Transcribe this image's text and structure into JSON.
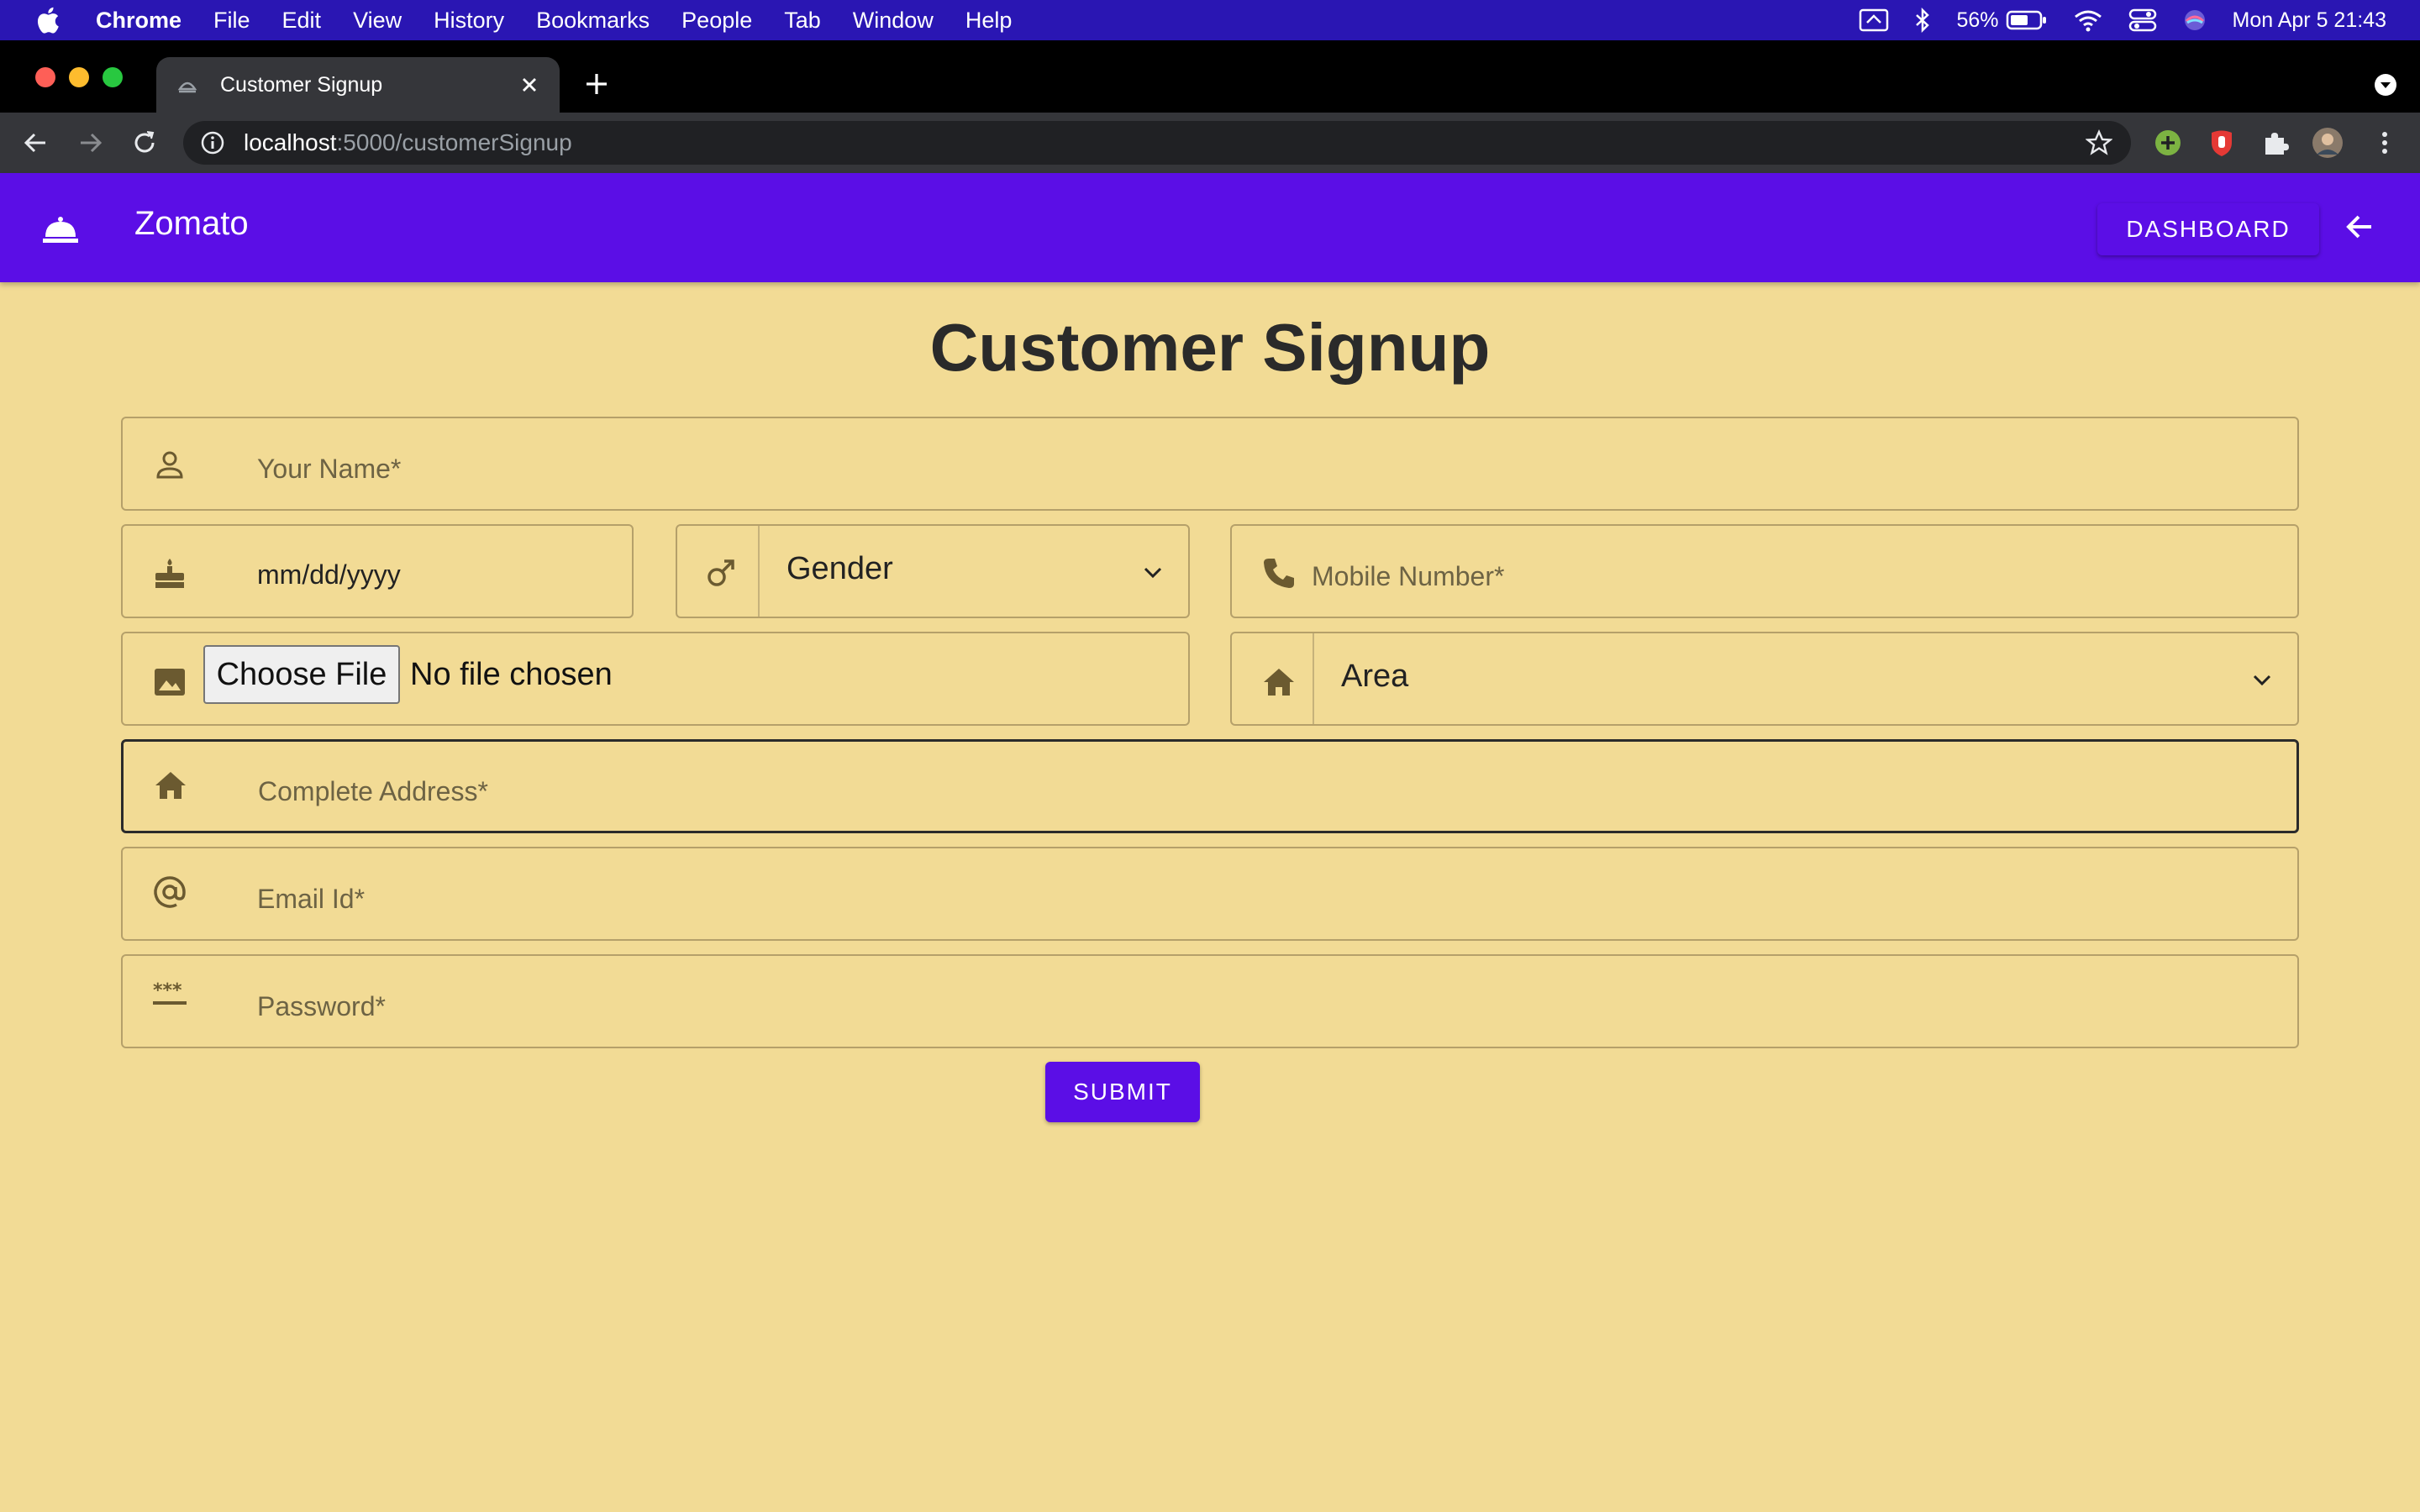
{
  "menubar": {
    "app": "Chrome",
    "items": [
      "File",
      "Edit",
      "View",
      "History",
      "Bookmarks",
      "People",
      "Tab",
      "Window",
      "Help"
    ],
    "battery": "56%",
    "datetime": "Mon Apr 5  21:43"
  },
  "browser": {
    "tab_title": "Customer Signup",
    "url_host": "localhost",
    "url_path": ":5000/customerSignup"
  },
  "appbar": {
    "brand": "Zomato",
    "dashboard_label": "DASHBOARD"
  },
  "page": {
    "title": "Customer Signup"
  },
  "form": {
    "name_placeholder": "Your Name*",
    "dob_value": "mm/dd/yyyy",
    "gender_selected": "Gender",
    "mobile_placeholder": "Mobile Number*",
    "file_button": "Choose File",
    "file_status": "No file chosen",
    "area_selected": "Area",
    "address_placeholder": "Complete Address*",
    "email_placeholder": "Email Id*",
    "password_placeholder": "Password*",
    "submit_label": "SUBMIT"
  },
  "colors": {
    "accent": "#5b0ee6",
    "page_background": "#f2db95",
    "menubar": "#2a16b3"
  },
  "icons": {
    "name": "person-icon",
    "dob": "cake-icon",
    "gender": "male-icon",
    "mobile": "phone-icon",
    "photo": "image-icon",
    "area": "home-icon",
    "address": "home-icon",
    "email": "at-sign-icon",
    "password": "password-icon"
  }
}
